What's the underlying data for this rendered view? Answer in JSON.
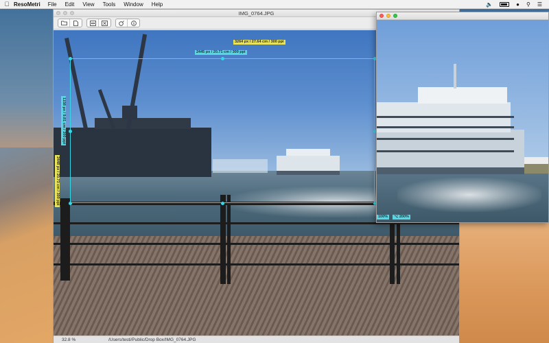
{
  "menubar": {
    "app_name": "ResoMetri",
    "menus": [
      "File",
      "Edit",
      "View",
      "Tools",
      "Window",
      "Help"
    ]
  },
  "main_window": {
    "title": "IMG_0764.JPG",
    "toolbar": {
      "group1": [
        "folder-icon",
        "document-icon"
      ],
      "group2": [
        "fit-width-icon",
        "fit-height-icon"
      ],
      "group3": [
        "color-picker-icon",
        "info-icon"
      ]
    },
    "measurements": {
      "image_width": "3264 px / 27.64 cm / 300 ppi",
      "selection_width": "2445 px / 20.71 cm / 300 ppi",
      "selection_height": "1158 px / 9.81 cm / 300 ppi",
      "image_height": "2448 px / 20.73 cm / 300 ppi"
    },
    "status": {
      "zoom": "32.8 %",
      "path": "/Users/testi/Public/Drop Box/IMG_0764.JPG"
    }
  },
  "loupe_window": {
    "zoom_label": "100%",
    "zoom_label_alt": "⌥ 200%"
  },
  "colors": {
    "selection": "#36d7e8",
    "tag_yellow": "#e8e35a",
    "tag_cyan": "#58d6e4"
  }
}
